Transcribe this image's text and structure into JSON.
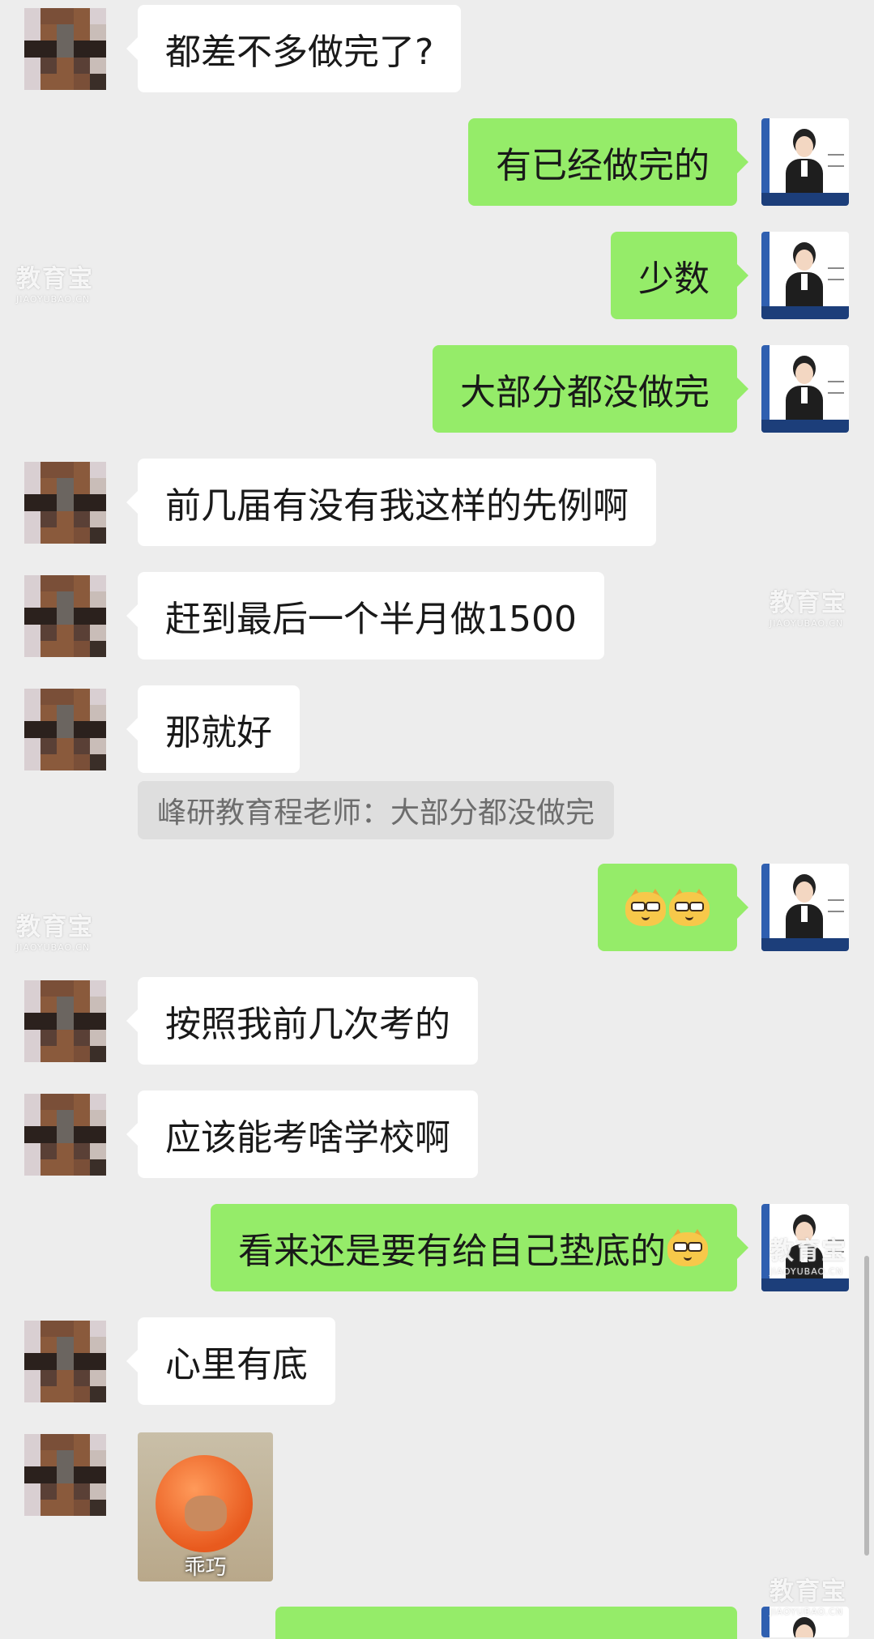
{
  "messages": [
    {
      "side": "left",
      "text": "都差不多做完了?"
    },
    {
      "side": "right",
      "text": "有已经做完的"
    },
    {
      "side": "right",
      "text": "少数"
    },
    {
      "side": "right",
      "text": "大部分都没做完"
    },
    {
      "side": "left",
      "text": "前几届有没有我这样的先例啊"
    },
    {
      "side": "left",
      "text": "赶到最后一个半月做1500"
    },
    {
      "side": "left",
      "text": "那就好"
    },
    {
      "side": "left",
      "text": "按照我前几次考的"
    },
    {
      "side": "left",
      "text": "应该能考啥学校啊"
    },
    {
      "side": "right",
      "text": "看来还是要有给自己垫底的"
    },
    {
      "side": "left",
      "text": "心里有底"
    }
  ],
  "quote": {
    "text": "峰研教育程老师：大部分都没做完"
  },
  "sticker": {
    "caption": "乖巧"
  },
  "watermark": {
    "main": "教育宝",
    "sub": "JIAOYUBAO.CN"
  },
  "colors": {
    "background": "#ededed",
    "sent_bubble": "#95ec69",
    "received_bubble": "#ffffff",
    "quote_bg": "#dedede"
  },
  "icons": {
    "emoji": "doge-emoji",
    "avatar_left": "pixelated-avatar",
    "avatar_right": "profile-photo"
  }
}
